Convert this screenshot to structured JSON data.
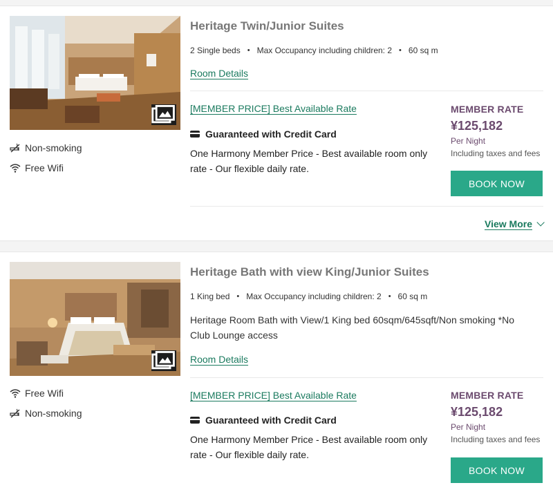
{
  "rooms": [
    {
      "title": "Heritage Twin/Junior Suites",
      "specs": [
        "2 Single beds",
        "Max Occupancy including children: 2",
        "60 sq m"
      ],
      "description": "",
      "room_details_label": "Room Details",
      "amenities": [
        "Non-smoking",
        "Free Wifi"
      ],
      "rate": {
        "name": "[MEMBER PRICE] Best Available Rate",
        "guarantee": "Guaranteed with Credit Card",
        "description": "One Harmony Member Price - Best available room only rate - Our flexible daily rate.",
        "member_label": "MEMBER RATE",
        "price": "¥125,182",
        "per_night": "Per Night",
        "taxes": "Including taxes and fees",
        "book_label": "BOOK NOW"
      },
      "view_more_label": "View More"
    },
    {
      "title": "Heritage Bath with view King/Junior Suites",
      "specs": [
        "1 King bed",
        "Max Occupancy including children: 2",
        "60 sq m"
      ],
      "description": "Heritage Room Bath with View/1 King bed 60sqm/645sqft/Non smoking *No Club Lounge access",
      "room_details_label": "Room Details",
      "amenities": [
        "Free Wifi",
        "Non-smoking"
      ],
      "rate": {
        "name": "[MEMBER PRICE] Best Available Rate",
        "guarantee": "Guaranteed with Credit Card",
        "description": "One Harmony Member Price - Best available room only rate - Our flexible daily rate.",
        "member_label": "MEMBER RATE",
        "price": "¥125,182",
        "per_night": "Per Night",
        "taxes": "Including taxes and fees",
        "book_label": "BOOK NOW"
      }
    }
  ],
  "colors": {
    "accent_green": "#2aa889",
    "link_green": "#1a7a5e",
    "member_purple": "#6b4a6e",
    "title_gray": "#777777"
  },
  "icons": [
    "no-smoking-icon",
    "wifi-icon",
    "gallery-icon",
    "credit-card-icon",
    "chevron-down-icon"
  ]
}
